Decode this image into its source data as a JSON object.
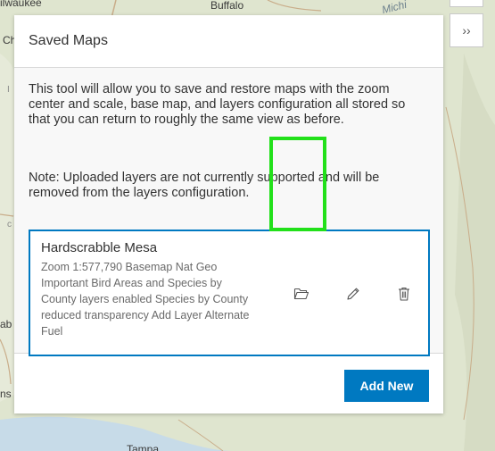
{
  "map": {
    "labels": {
      "milwaukee": "ilwaukee",
      "buffalo": "Buffalo",
      "chicago": "Chi",
      "michigan": "Michi",
      "tampa": "Tampa",
      "left_a": "I",
      "left_b": "c",
      "left_c": "ab",
      "left_d": "ns"
    },
    "colors": {
      "land": "#dfe5cf",
      "water": "#c7dbe8",
      "roads": "#c9ad8a"
    }
  },
  "expand_button": {
    "icon": "double-chevron-right-icon",
    "glyph": "››"
  },
  "panel": {
    "title": "Saved Maps",
    "description": "This tool will allow you to save and restore maps with the zoom center and scale, base map, and layers configuration all stored so that you can return to roughly the same view as before.",
    "note": "Note: Uploaded layers are not currently supported and will be removed from the layers configuration.",
    "saved_maps": [
      {
        "name": "Hardscrabble Mesa",
        "details": "Zoom 1:577,790 Basemap Nat Geo Important Bird Areas and Species by County layers enabled Species by County reduced transparency Add Layer Alternate Fuel",
        "actions": {
          "open_icon": "folder-open-icon",
          "edit_icon": "pencil-icon",
          "delete_icon": "trash-icon"
        }
      }
    ],
    "add_new_label": "Add New"
  },
  "colors": {
    "accent": "#0079c1",
    "highlight": "#22e01a",
    "text": "#323232",
    "muted_text": "#6a6a6a"
  }
}
